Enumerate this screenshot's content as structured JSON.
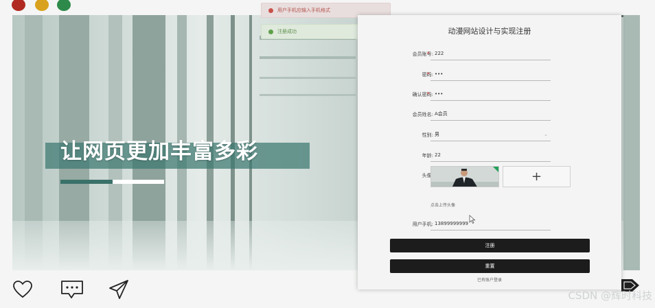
{
  "colors": {
    "dot_red": "#b02a21",
    "dot_yellow": "#d9a21e",
    "dot_green": "#2e8a4a",
    "accent_teal": "#3a7169",
    "button_dark": "#1c1c1c",
    "error_red": "#c8514a",
    "success_green": "#5ea04a"
  },
  "hero": {
    "slogan": "让网页更加丰富多彩",
    "slider_progress": 0.5
  },
  "toasts": {
    "error": "用户手机应输入手机格式",
    "success": "注册成功"
  },
  "form": {
    "title": "动漫网站设计与实现注册",
    "account": {
      "label": "会员账号:",
      "value": "222"
    },
    "password": {
      "label": "密码:",
      "value": "•••"
    },
    "confirm_password": {
      "label": "确认密码:",
      "value": "•••"
    },
    "name": {
      "label": "会员姓名:",
      "value": "A会员"
    },
    "gender": {
      "label": "性别:",
      "value": "男"
    },
    "age": {
      "label": "年龄:",
      "value": "22"
    },
    "avatar": {
      "label": "头像:",
      "hint": "点击上传头像",
      "add_symbol": "+"
    },
    "phone": {
      "label": "用户手机:",
      "value": "13899999999"
    },
    "required_mark": "*",
    "register_button": "注册",
    "reset_button": "重置",
    "login_link": "已有账户登录"
  },
  "icons": {
    "bottom": [
      "heart-icon",
      "comment-icon",
      "send-icon"
    ],
    "corner": "tag-icon"
  },
  "watermark": "CSDN @辉时科技"
}
